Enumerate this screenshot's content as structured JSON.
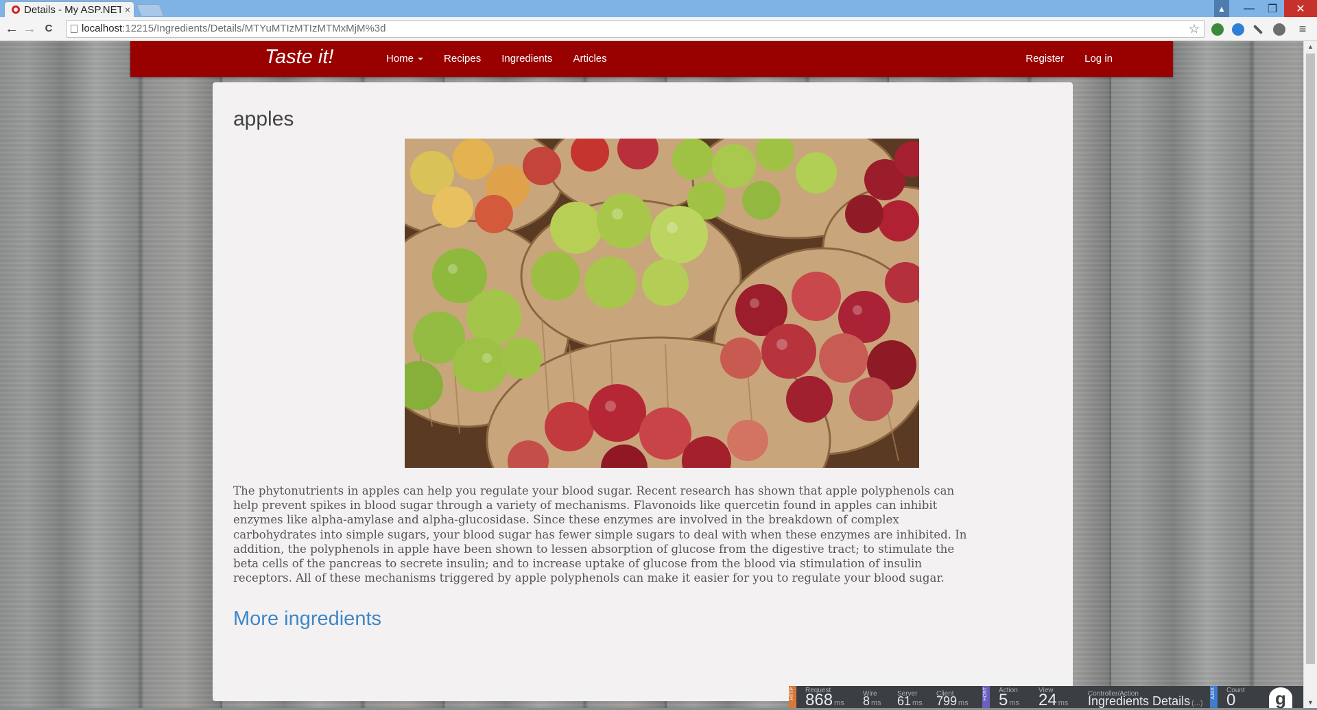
{
  "browser": {
    "tab_title": "Details - My ASP.NET",
    "tab_close": "×",
    "url_host": "localhost",
    "url_rest": ":12215/Ingredients/Details/MTYuMTIzMTIzMTMxMjM%3d",
    "window_controls": {
      "minimize": "—",
      "maximize": "❐",
      "close": "✕",
      "user": "▲"
    },
    "back": "←",
    "forward": "→",
    "reload": "C",
    "bookmark_star": "☆",
    "menu": "≡"
  },
  "navbar": {
    "brand": "Taste it!",
    "links": [
      {
        "label": "Home",
        "has_caret": true
      },
      {
        "label": "Recipes"
      },
      {
        "label": "Ingredients"
      },
      {
        "label": "Articles"
      }
    ],
    "right_links": [
      {
        "label": "Register"
      },
      {
        "label": "Log in"
      }
    ],
    "color": "#990000"
  },
  "ingredient": {
    "name": "apples",
    "image_alt": "baskets of green and red apples",
    "description": "The phytonutrients in apples can help you regulate your blood sugar. Recent research has shown that apple polyphenols can help prevent spikes in blood sugar through a variety of mechanisms. Flavonoids like quercetin found in apples can inhibit enzymes like alpha-amylase and alpha-glucosidase. Since these enzymes are involved in the breakdown of complex carbohydrates into simple sugars, your blood sugar has fewer simple sugars to deal with when these enzymes are inhibited. In addition, the polyphenols in apple have been shown to lessen absorption of glucose from the digestive tract; to stimulate the beta cells of the pancreas to secrete insulin; and to increase uptake of glucose from the blood via stimulation of insulin receptors. All of these mechanisms triggered by apple polyphenols can make it easier for you to regulate your blood sugar.",
    "more_link": "More ingredients",
    "link_color": "#3d87c8"
  },
  "glimpse": {
    "http_tag": "HTTP",
    "host_tag": "HOST",
    "ajax_tag": "AJAX",
    "request": {
      "label": "Request",
      "value": "868",
      "unit": "ms"
    },
    "wire": {
      "label": "Wire",
      "value": "8",
      "unit": "ms"
    },
    "server": {
      "label": "Server",
      "value": "61",
      "unit": "ms"
    },
    "client": {
      "label": "Client",
      "value": "799",
      "unit": "ms"
    },
    "action": {
      "label": "Action",
      "value": "5",
      "unit": "ms"
    },
    "view": {
      "label": "View",
      "value": "24",
      "unit": "ms"
    },
    "controller_action": {
      "label": "Controller/Action",
      "value": "Ingredients Details",
      "suffix": "(...)"
    },
    "count": {
      "label": "Count",
      "value": "0"
    },
    "logo": "g"
  }
}
